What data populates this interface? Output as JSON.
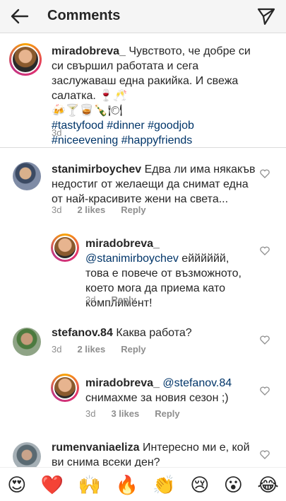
{
  "header": {
    "title": "Comments",
    "back_icon": "arrow-left-icon",
    "send_icon": "paper-plane-icon"
  },
  "caption": {
    "username": "miradobreva_",
    "text": "Чувството, че добре си си свършил работата и сега заслужаваш една ракийка. И свежа салатка.",
    "emojis_line1": "🍷🥂",
    "emojis_line2": "🍻🍸🥃🍾🍽",
    "hashtags_line1": "#tastyfood #dinner #goodjob",
    "hashtags_line2": "#niceevening #happyfriends",
    "time": "3d"
  },
  "comments": [
    {
      "username": "stanimirboychev",
      "text": "Едва ли има някакъв недостиг от желаещи да снимат една от най-красивите жени на света...",
      "time": "3d",
      "likes": "2 likes",
      "reply": "Reply"
    },
    {
      "username": "miradobreva_",
      "mention": "@stanimirboychev",
      "text": "ейййййй, това е повече от възможното, което мога да приема като комплимент!",
      "time": "3d",
      "reply": "Reply"
    },
    {
      "username": "stefanov.84",
      "text": "Каква работа?",
      "time": "3d",
      "likes": "2 likes",
      "reply": "Reply"
    },
    {
      "username": "miradobreva_",
      "mention": "@stefanov.84",
      "text": "снимахме за новия сезон ;)",
      "time": "3d",
      "likes": "3 likes",
      "reply": "Reply"
    },
    {
      "username": "rumenvaniaeliza",
      "text": "Интересно ми е, кой ви снима  всеки ден?"
    }
  ],
  "emoji_bar": [
    "😍",
    "❤️",
    "🙌",
    "🔥",
    "👏",
    "😢",
    "😮",
    "😂"
  ]
}
